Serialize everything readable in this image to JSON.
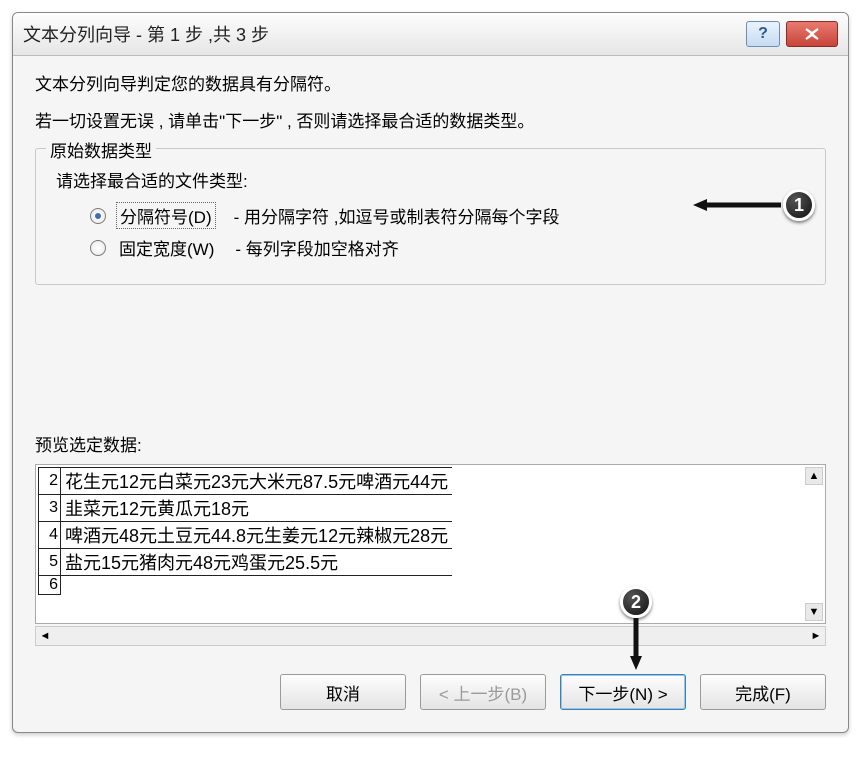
{
  "title": "文本分列向导 - 第 1 步 ,共 3 步",
  "intro1": "文本分列向导判定您的数据具有分隔符。",
  "intro2": "若一切设置无误 , 请单击\"下一步\" , 否则请选择最合适的数据类型。",
  "fieldset_legend": "原始数据类型",
  "choose_label": "请选择最合适的文件类型:",
  "opt1_label": "分隔符号(D)",
  "opt1_desc": "- 用分隔字符 ,如逗号或制表符分隔每个字段",
  "opt2_label": "固定宽度(W)",
  "opt2_desc": "- 每列字段加空格对齐",
  "selected_option": 0,
  "preview_label": "预览选定数据:",
  "preview_rows": [
    {
      "n": "2",
      "t": "花生元12元白菜元23元大米元87.5元啤酒元44元"
    },
    {
      "n": "3",
      "t": "韭菜元12元黄瓜元18元"
    },
    {
      "n": "4",
      "t": "啤酒元48元土豆元44.8元生姜元12元辣椒元28元"
    },
    {
      "n": "5",
      "t": "盐元15元猪肉元48元鸡蛋元25.5元"
    },
    {
      "n": "6",
      "t": ""
    }
  ],
  "buttons": {
    "cancel": "取消",
    "back": "< 上一步(B)",
    "next": "下一步(N) >",
    "finish": "完成(F)"
  },
  "callouts": {
    "c1": "1",
    "c2": "2"
  }
}
